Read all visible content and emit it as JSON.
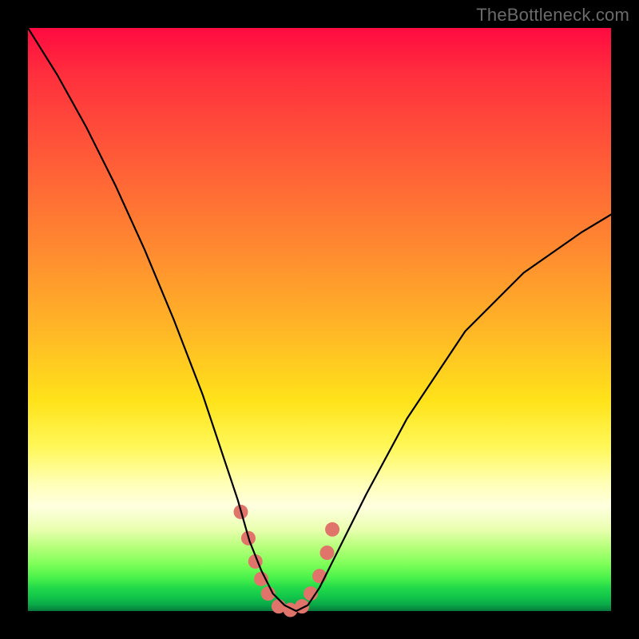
{
  "watermark": "TheBottleneck.com",
  "chart_data": {
    "type": "line",
    "title": "",
    "xlabel": "",
    "ylabel": "",
    "xlim": [
      0,
      100
    ],
    "ylim": [
      0,
      100
    ],
    "grid": false,
    "series": [
      {
        "name": "bottleneck-curve",
        "color": "#000000",
        "x": [
          0,
          5,
          10,
          15,
          20,
          25,
          30,
          33,
          36,
          38,
          40,
          42,
          44,
          46,
          48,
          50,
          53,
          58,
          65,
          75,
          85,
          95,
          100
        ],
        "values": [
          100,
          92,
          83,
          73,
          62,
          50,
          37,
          28,
          19,
          12,
          7,
          3,
          1,
          0,
          1,
          4,
          10,
          20,
          33,
          48,
          58,
          65,
          68
        ]
      }
    ],
    "annotations": [
      {
        "name": "valley-marker",
        "type": "scatter",
        "color": "#e0746b",
        "x": [
          36.5,
          37.8,
          39.0,
          40.0,
          41.2,
          43.0,
          45.0,
          47.0,
          48.5,
          50.0,
          51.3,
          52.2
        ],
        "y": [
          17.0,
          12.5,
          8.5,
          5.5,
          3.0,
          0.8,
          0.2,
          0.8,
          3.0,
          6.0,
          10.0,
          14.0
        ],
        "radius": 9
      }
    ]
  }
}
